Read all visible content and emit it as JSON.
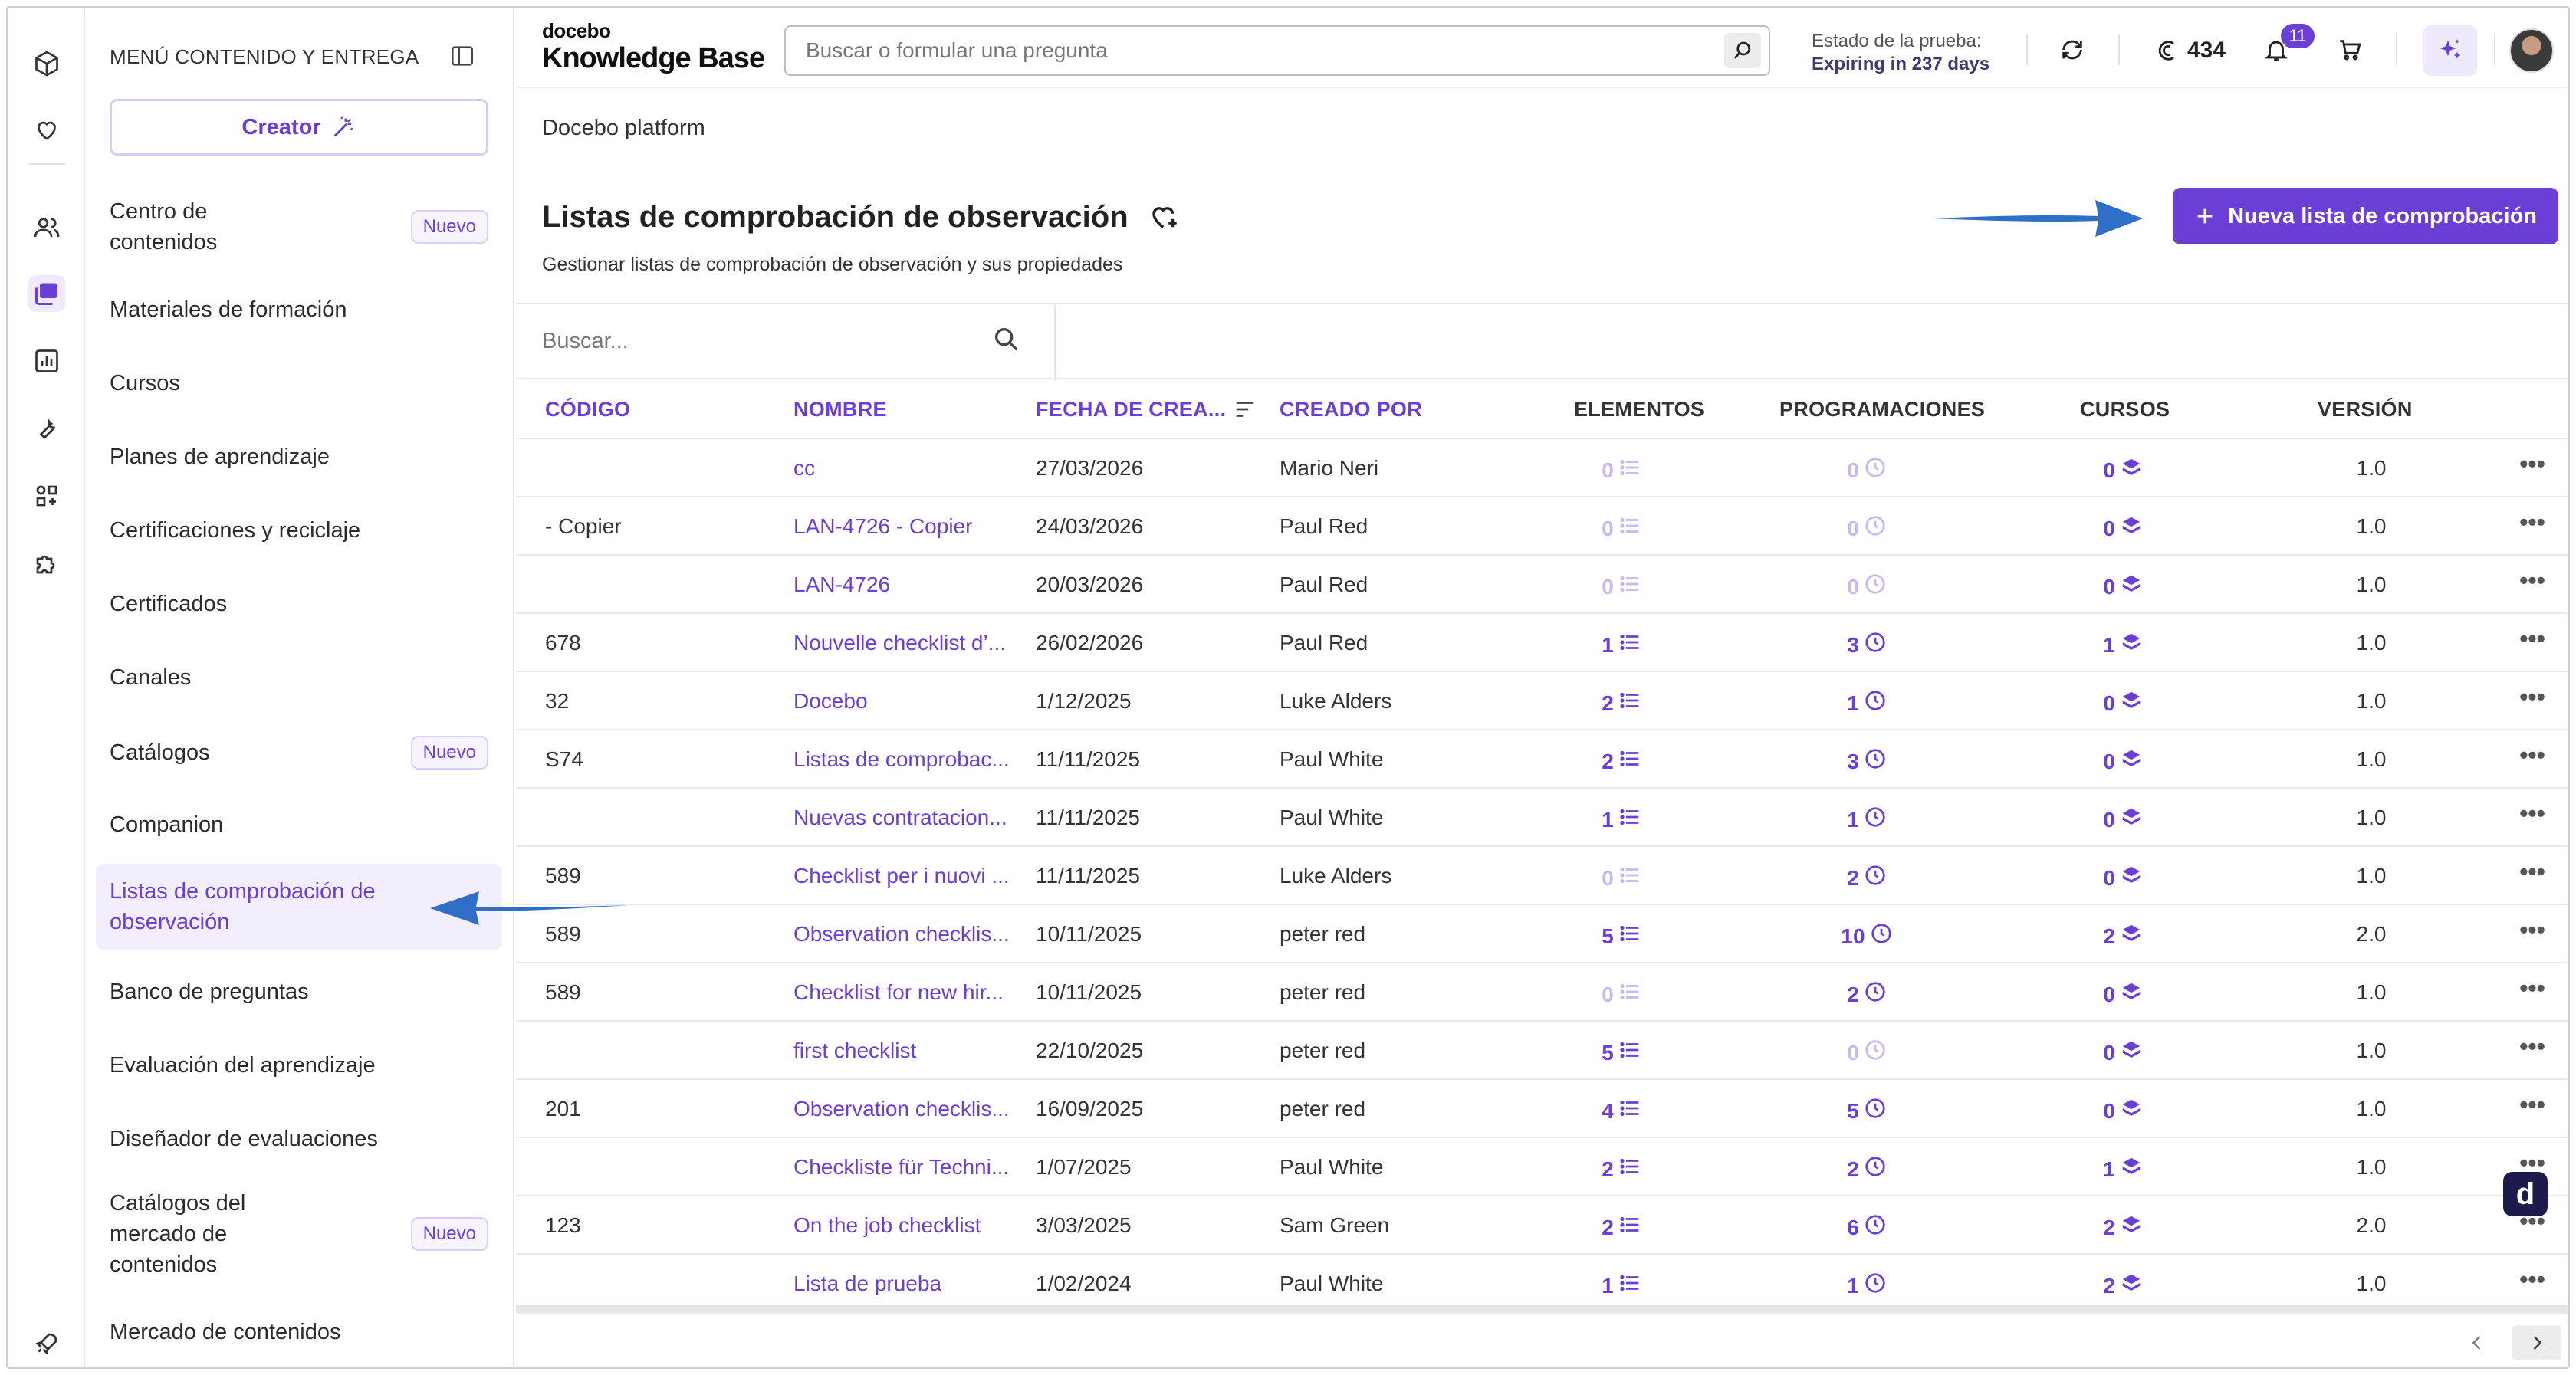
{
  "colors": {
    "accent": "#6b3ed6",
    "accent_faded": "#c8b8f0",
    "arrow": "#2f6fc7"
  },
  "sidebar": {
    "title": "MENÚ CONTENIDO Y ENTREGA",
    "creator_label": "Creator",
    "items": [
      {
        "label": "Centro de contenidos",
        "badge": "Nuevo"
      },
      {
        "label": "Materiales de formación"
      },
      {
        "label": "Cursos"
      },
      {
        "label": "Planes de aprendizaje"
      },
      {
        "label": "Certificaciones y reciclaje"
      },
      {
        "label": "Certificados"
      },
      {
        "label": "Canales"
      },
      {
        "label": "Catálogos",
        "badge": "Nuevo"
      },
      {
        "label": "Companion"
      },
      {
        "label": "Listas de comprobación de observación",
        "active": true
      },
      {
        "label": "Banco de preguntas"
      },
      {
        "label": "Evaluación del aprendizaje"
      },
      {
        "label": "Diseñador de evaluaciones"
      },
      {
        "label": "Catálogos del mercado de contenidos",
        "badge": "Nuevo"
      },
      {
        "label": "Mercado de contenidos"
      }
    ]
  },
  "header": {
    "logo_top": "docebo",
    "logo_bottom": "Knowledge Base",
    "search_placeholder": "Buscar o formular una pregunta",
    "trial_label": "Estado de la prueba:",
    "trial_value": "Expiring in 237 days",
    "credits": "434",
    "notifications": "11"
  },
  "page": {
    "breadcrumb": "Docebo platform",
    "title": "Listas de comprobación de observación",
    "subtitle": "Gestionar listas de comprobación de observación y sus propiedades",
    "new_button": "Nueva lista de comprobación",
    "table_search_placeholder": "Buscar..."
  },
  "table": {
    "columns": [
      "CÓDIGO",
      "NOMBRE",
      "FECHA DE CREA...",
      "CREADO POR",
      "ELEMENTOS",
      "PROGRAMACIONES",
      "CURSOS",
      "VERSIÓN"
    ],
    "rows": [
      {
        "code": "",
        "name": "cc",
        "date": "27/03/2026",
        "by": "Mario Neri",
        "elements": "0",
        "schedules": "0",
        "courses": "0",
        "version": "1.0"
      },
      {
        "code": "- Copier",
        "name": "LAN-4726 - Copier",
        "date": "24/03/2026",
        "by": "Paul Red",
        "elements": "0",
        "schedules": "0",
        "courses": "0",
        "version": "1.0"
      },
      {
        "code": "",
        "name": "LAN-4726",
        "date": "20/03/2026",
        "by": "Paul Red",
        "elements": "0",
        "schedules": "0",
        "courses": "0",
        "version": "1.0"
      },
      {
        "code": "678",
        "name": "Nouvelle checklist d’...",
        "date": "26/02/2026",
        "by": "Paul Red",
        "elements": "1",
        "schedules": "3",
        "courses": "1",
        "version": "1.0"
      },
      {
        "code": "32",
        "name": "Docebo",
        "date": "1/12/2025",
        "by": "Luke Alders",
        "elements": "2",
        "schedules": "1",
        "courses": "0",
        "version": "1.0"
      },
      {
        "code": "S74",
        "name": "Listas de comprobac...",
        "date": "11/11/2025",
        "by": "Paul White",
        "elements": "2",
        "schedules": "3",
        "courses": "0",
        "version": "1.0"
      },
      {
        "code": "",
        "name": "Nuevas contratacion...",
        "date": "11/11/2025",
        "by": "Paul White",
        "elements": "1",
        "schedules": "1",
        "courses": "0",
        "version": "1.0"
      },
      {
        "code": "589",
        "name": "Checklist per i nuovi ...",
        "date": "11/11/2025",
        "by": "Luke Alders",
        "elements": "0",
        "schedules": "2",
        "courses": "0",
        "version": "1.0"
      },
      {
        "code": "589",
        "name": "Observation checklis...",
        "date": "10/11/2025",
        "by": "peter red",
        "elements": "5",
        "schedules": "10",
        "courses": "2",
        "version": "2.0"
      },
      {
        "code": "589",
        "name": "Checklist for new hir...",
        "date": "10/11/2025",
        "by": "peter red",
        "elements": "0",
        "schedules": "2",
        "courses": "0",
        "version": "1.0"
      },
      {
        "code": "",
        "name": "first checklist",
        "date": "22/10/2025",
        "by": "peter red",
        "elements": "5",
        "schedules": "0",
        "courses": "0",
        "version": "1.0"
      },
      {
        "code": "201",
        "name": "Observation checklis...",
        "date": "16/09/2025",
        "by": "peter red",
        "elements": "4",
        "schedules": "5",
        "courses": "0",
        "version": "1.0"
      },
      {
        "code": "",
        "name": "Checkliste für Techni...",
        "date": "1/07/2025",
        "by": "Paul White",
        "elements": "2",
        "schedules": "2",
        "courses": "1",
        "version": "1.0"
      },
      {
        "code": "123",
        "name": "On the job checklist",
        "date": "3/03/2025",
        "by": "Sam Green",
        "elements": "2",
        "schedules": "6",
        "courses": "2",
        "version": "2.0"
      },
      {
        "code": "",
        "name": "Lista de prueba",
        "date": "1/02/2024",
        "by": "Paul White",
        "elements": "1",
        "schedules": "1",
        "courses": "2",
        "version": "1.0"
      }
    ]
  }
}
